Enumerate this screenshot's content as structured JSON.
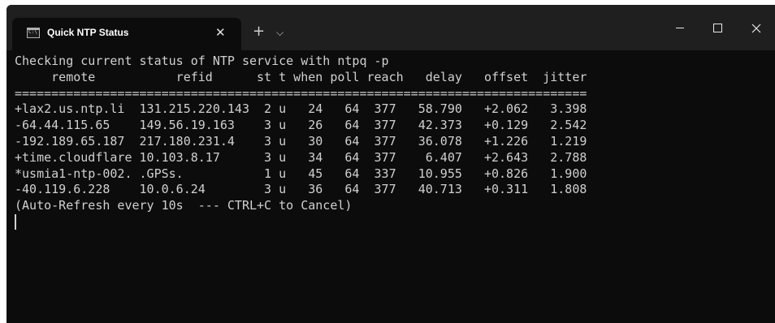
{
  "window": {
    "tab_title": "Quick NTP Status",
    "tab_icon": "terminal-icon",
    "new_tab_symbol": "+",
    "dropdown_symbol": "⌵",
    "close_tab_symbol": "✕"
  },
  "terminal": {
    "command_line": "Checking current status of NTP service with ntpq -p",
    "header": "     remote           refid      st t when poll reach   delay   offset  jitter",
    "separator": "==============================================================================",
    "rows": [
      "+lax2.us.ntp.li  131.215.220.143  2 u   24   64  377   58.790   +2.062   3.398",
      "-64.44.115.65    149.56.19.163    3 u   26   64  377   42.373   +0.129   2.542",
      "-192.189.65.187  217.180.231.4    3 u   30   64  377   36.078   +1.226   1.219",
      "+time.cloudflare 10.103.8.17      3 u   34   64  377    6.407   +2.643   2.788",
      "*usmia1-ntp-002. .GPSs.           1 u   45   64  337   10.955   +0.826   1.900",
      "-40.119.6.228    10.0.6.24        3 u   36   64  377   40.713   +0.311   1.808"
    ],
    "footer": "(Auto-Refresh every 10s  --- CTRL+C to Cancel)"
  },
  "colors": {
    "background": "#0c0c0c",
    "titlebar": "#1f1f1f",
    "text": "#d0d0d0"
  }
}
